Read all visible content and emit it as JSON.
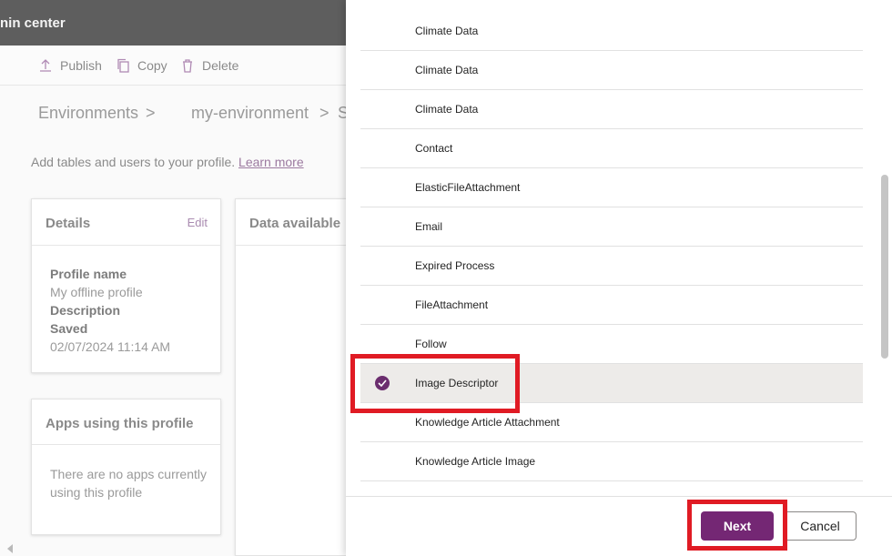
{
  "app": {
    "title": "nin center"
  },
  "command_bar": {
    "publish": "Publish",
    "copy": "Copy",
    "delete": "Delete"
  },
  "breadcrumb": {
    "items": [
      "Environments",
      "my-environment",
      "S"
    ],
    "separator": ">"
  },
  "intro": {
    "text": "Add tables and users to your profile.",
    "link": "Learn more"
  },
  "details_card": {
    "title": "Details",
    "edit": "Edit",
    "profile_name_label": "Profile name",
    "profile_name_value": "My offline profile",
    "description_label": "Description",
    "saved_label": "Saved",
    "saved_value": "02/07/2024 11:14 AM"
  },
  "data_card": {
    "title": "Data available"
  },
  "apps_card": {
    "title": "Apps using this profile",
    "empty_text": "There are no apps currently using this profile"
  },
  "panel": {
    "tables": [
      {
        "label": "Climate Data",
        "selected": false
      },
      {
        "label": "Climate Data",
        "selected": false
      },
      {
        "label": "Climate Data",
        "selected": false
      },
      {
        "label": "Contact",
        "selected": false
      },
      {
        "label": "ElasticFileAttachment",
        "selected": false
      },
      {
        "label": "Email",
        "selected": false
      },
      {
        "label": "Expired Process",
        "selected": false
      },
      {
        "label": "FileAttachment",
        "selected": false
      },
      {
        "label": "Follow",
        "selected": false
      },
      {
        "label": "Image Descriptor",
        "selected": true
      },
      {
        "label": "Knowledge Article Attachment",
        "selected": false
      },
      {
        "label": "Knowledge Article Image",
        "selected": false
      }
    ],
    "next_label": "Next",
    "cancel_label": "Cancel"
  },
  "colors": {
    "accent": "#742774",
    "highlight": "#e01b24",
    "selected_row": "#edebe9"
  }
}
